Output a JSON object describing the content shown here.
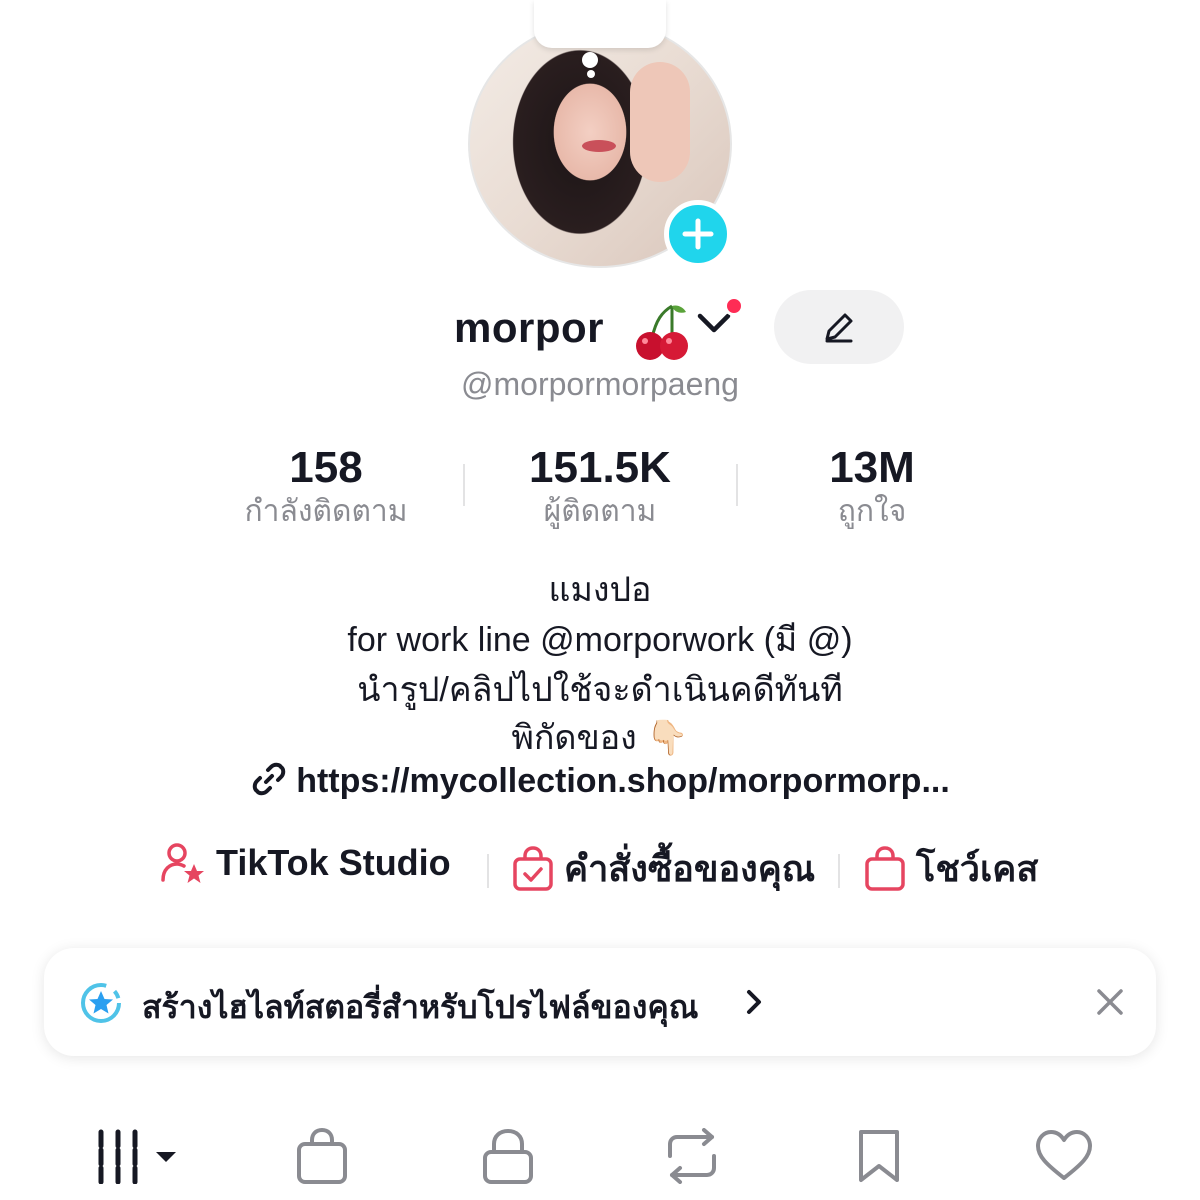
{
  "profile": {
    "display_name": "morpor",
    "name_emoji": "🍒",
    "handle": "@morpormorpaeng"
  },
  "stats": [
    {
      "value": "158",
      "label": "กำลังติดตาม"
    },
    {
      "value": "151.5K",
      "label": "ผู้ติดตาม"
    },
    {
      "value": "13M",
      "label": "ถูกใจ"
    }
  ],
  "bio": {
    "lines": [
      "แมงปอ",
      "for work line @morporwork (มี @)",
      "นำรูป/คลิปไปใช้จะดำเนินคดีทันที",
      "พิกัดของ 👇🏻"
    ],
    "link": "https://mycollection.shop/morpormorp..."
  },
  "shortcuts": [
    {
      "label": "TikTok Studio",
      "icon": "person-star-icon"
    },
    {
      "label": "คำสั่งซื้อของคุณ",
      "icon": "bag-check-icon"
    },
    {
      "label": "โชว์เคส",
      "icon": "bag-icon"
    }
  ],
  "banner": {
    "text": "สร้างไฮไลท์สตอรี่สำหรับโปรไฟล์ของคุณ",
    "icon": "star-badge-icon"
  },
  "tabs": [
    {
      "name": "videos-grid-icon"
    },
    {
      "name": "shop-bag-icon"
    },
    {
      "name": "lock-icon"
    },
    {
      "name": "repost-icon"
    },
    {
      "name": "bookmark-icon"
    },
    {
      "name": "heart-icon"
    }
  ],
  "colors": {
    "accent_red": "#fe2c55",
    "add_button": "#20d5ec",
    "muted_text": "#8a8b91",
    "icon_pink": "#e64560"
  }
}
